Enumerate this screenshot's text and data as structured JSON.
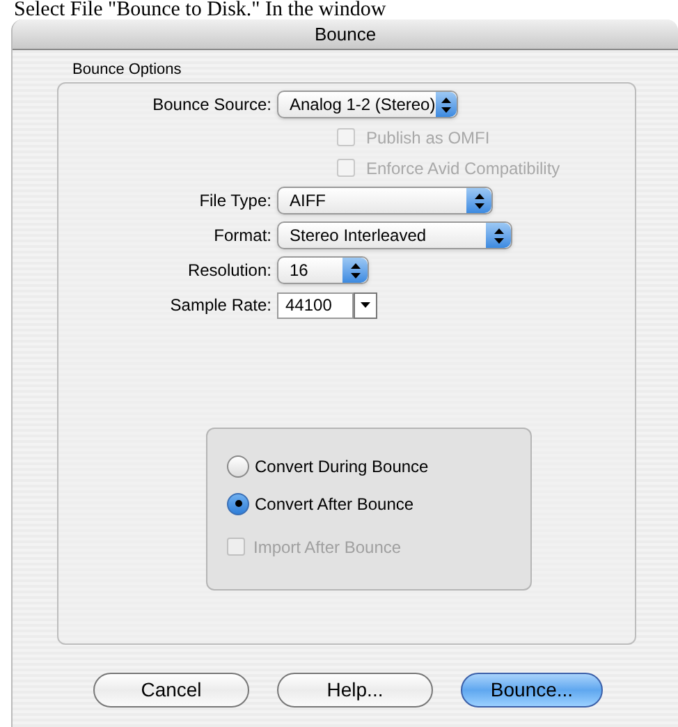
{
  "caption": "Select File \"Bounce to Disk.\" In the window",
  "window": {
    "title": "Bounce"
  },
  "group": {
    "title": "Bounce Options",
    "fields": [
      {
        "kind": "popup",
        "label": "Bounce Source:",
        "value": "Analog 1-2 (Stereo)"
      },
      {
        "kind": "checkbox",
        "label": "Publish as OMFI",
        "checked": false,
        "disabled": true
      },
      {
        "kind": "checkbox",
        "label": "Enforce Avid Compatibility",
        "checked": false,
        "disabled": true
      },
      {
        "kind": "popup",
        "label": "File Type:",
        "value": "AIFF"
      },
      {
        "kind": "popup",
        "label": "Format:",
        "value": "Stereo Interleaved"
      },
      {
        "kind": "popup",
        "label": "Resolution:",
        "value": "16"
      },
      {
        "kind": "combo",
        "label": "Sample Rate:",
        "value": "44100"
      }
    ],
    "conversion": {
      "options": [
        {
          "label": "Convert During Bounce",
          "selected": false
        },
        {
          "label": "Convert After Bounce",
          "selected": true
        }
      ],
      "import": {
        "label": "Import After Bounce",
        "checked": false,
        "disabled": true
      }
    }
  },
  "buttons": [
    {
      "label": "Cancel",
      "default": false
    },
    {
      "label": "Help...",
      "default": false
    },
    {
      "label": "Bounce...",
      "default": true
    }
  ]
}
